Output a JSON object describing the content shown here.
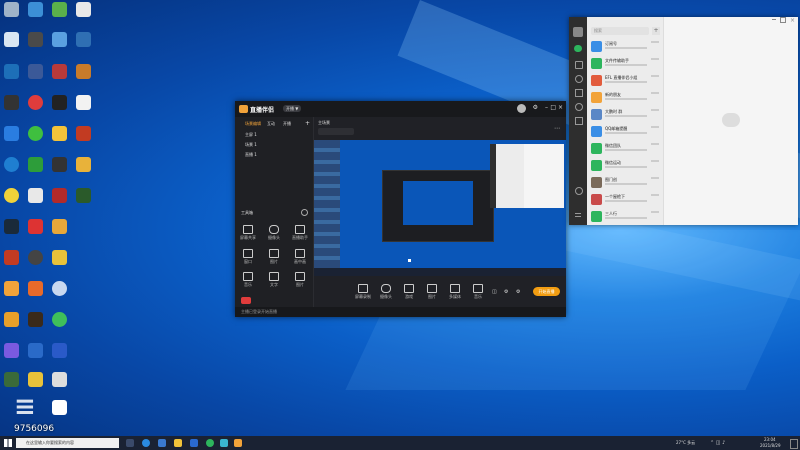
{
  "desktop": {
    "overlay_number": "9756096"
  },
  "stream_app": {
    "title": "直播伴侣",
    "badge": "开播 ▼",
    "left_tabs": [
      "场景编辑",
      "互动",
      "开播"
    ],
    "scenes": [
      "主屏 1",
      "场景 1",
      "直播 1"
    ],
    "tools_title": "工具箱",
    "tools": [
      "屏幕共享",
      "摄像头",
      "直播助手",
      "窗口",
      "图片",
      "画中画",
      "音乐",
      "文字",
      "图片"
    ],
    "scene_tab_label": "主场景",
    "preview_tools": [
      "屏幕录制",
      "摄像头",
      "游戏",
      "图片",
      "多媒体",
      "音乐",
      "图片"
    ],
    "start_button": "开始直播",
    "status_text": "主播已登录开始直播"
  },
  "wechat": {
    "search_placeholder": "搜索",
    "chats": [
      {
        "name": "订阅号",
        "color": "#3a8ee6"
      },
      {
        "name": "文件传输助手",
        "color": "#2db55d"
      },
      {
        "name": "EFL 直播伴侣小组",
        "color": "#e25c3d"
      },
      {
        "name": "新的朋友",
        "color": "#f2a33a"
      },
      {
        "name": "大鹏时 群",
        "color": "#5a87c6"
      },
      {
        "name": "QQ邮箱提醒",
        "color": "#3a8ee6"
      },
      {
        "name": "微信团队",
        "color": "#2db55d"
      },
      {
        "name": "微信运动",
        "color": "#2db55d"
      },
      {
        "name": "图门创",
        "color": "#7a6a5a"
      },
      {
        "name": "一个屋檐下",
        "color": "#c94b4b"
      },
      {
        "name": "三人行",
        "color": "#2db55d"
      }
    ]
  },
  "taskbar": {
    "search_placeholder": "在这里输入你要搜索的内容",
    "weather": "27°C 多云",
    "time": "23:04",
    "date": "2021/8/29"
  }
}
